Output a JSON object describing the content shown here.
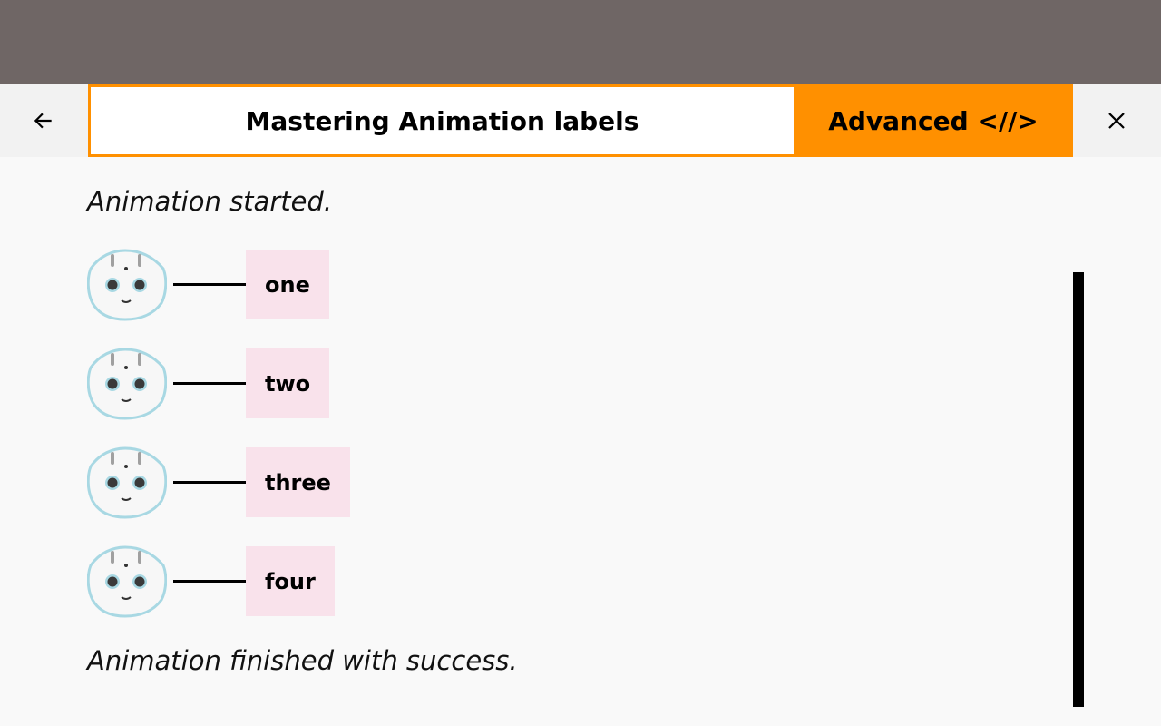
{
  "header": {
    "title": "Mastering Animation labels",
    "mode_label": "Advanced <//>",
    "back_icon": "arrow-left-icon",
    "close_icon": "close-icon"
  },
  "colors": {
    "accent": "#ff9000",
    "status_bar": "#6f6665",
    "chip_background": "#f9e2eb",
    "robot_outline": "#a8d8e3"
  },
  "log": {
    "started": "Animation started.",
    "finished": "Animation finished with success.",
    "labels": [
      "one",
      "two",
      "three",
      "four"
    ]
  }
}
